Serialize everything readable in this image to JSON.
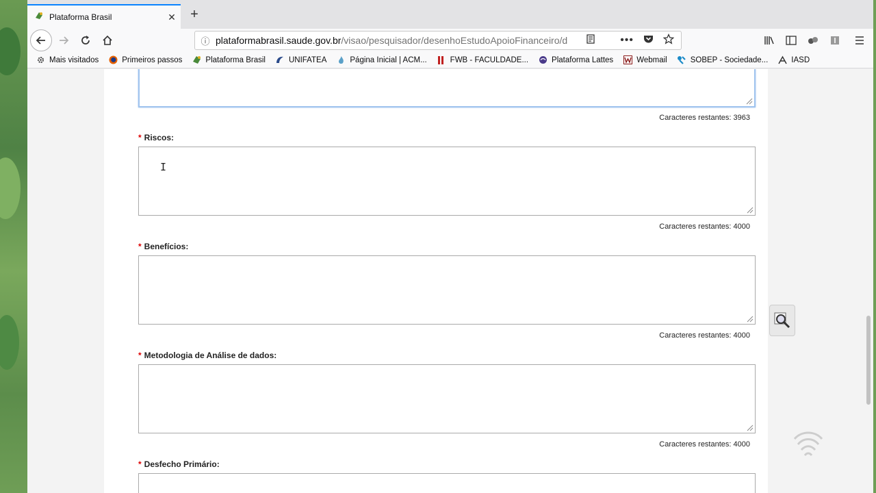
{
  "tab": {
    "title": "Plataforma Brasil"
  },
  "urlbar": {
    "domain": "plataformabrasil.saude.gov.br",
    "path": "/visao/pesquisador/desenhoEstudoApoioFinanceiro/d"
  },
  "bookmarks": [
    {
      "label": "Mais visitados",
      "icon": "gear-icon"
    },
    {
      "label": "Primeiros passos",
      "icon": "firefox-icon"
    },
    {
      "label": "Plataforma Brasil",
      "icon": "plataforma-icon"
    },
    {
      "label": "UNIFATEA",
      "icon": "unifatea-icon"
    },
    {
      "label": "Página Inicial | ACM...",
      "icon": "acm-icon"
    },
    {
      "label": "FWB - FACULDADE...",
      "icon": "fwb-icon"
    },
    {
      "label": "Plataforma Lattes",
      "icon": "lattes-icon"
    },
    {
      "label": "Webmail",
      "icon": "webmail-icon"
    },
    {
      "label": "SOBEP - Sociedade...",
      "icon": "sobep-icon"
    },
    {
      "label": "IASD",
      "icon": "iasd-icon"
    }
  ],
  "form": {
    "previous_counter": {
      "label": "Caracteres restantes:",
      "value": "3963"
    },
    "fields": [
      {
        "label": "Riscos:",
        "value": "",
        "counter_label": "Caracteres restantes:",
        "counter_value": "4000"
      },
      {
        "label": "Benefícios:",
        "value": "",
        "counter_label": "Caracteres restantes:",
        "counter_value": "4000"
      },
      {
        "label": "Metodologia de Análise de dados:",
        "value": "",
        "counter_label": "Caracteres restantes:",
        "counter_value": "4000"
      },
      {
        "label": "Desfecho Primário:",
        "value": ""
      }
    ],
    "required_marker": "*"
  },
  "colors": {
    "accent": "#0a84ff",
    "required": "#dd0000",
    "focus": "#9fc3ee"
  }
}
